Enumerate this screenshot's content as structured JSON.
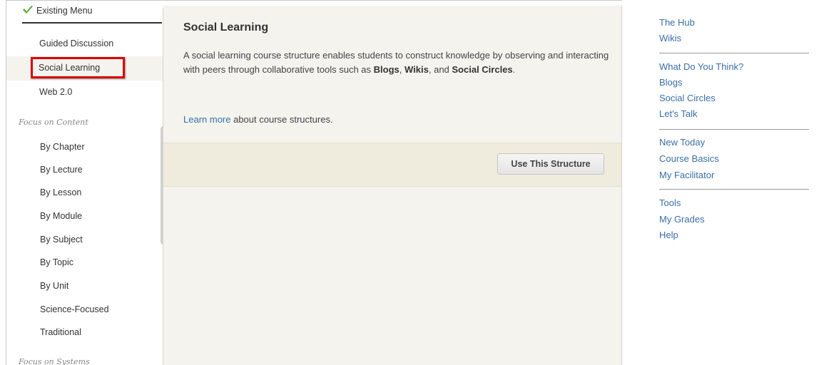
{
  "left_menu": {
    "existing_label": "Existing Menu",
    "items": [
      {
        "label": "Guided Discussion"
      },
      {
        "label": "Social Learning",
        "selected": true
      },
      {
        "label": "Web 2.0"
      }
    ],
    "section_content": "Focus on Content",
    "content_items": [
      "By Chapter",
      "By Lecture",
      "By Lesson",
      "By Module",
      "By Subject",
      "By Topic",
      "By Unit",
      "Science-Focused",
      "Traditional"
    ],
    "section_systems": "Focus on Systems"
  },
  "detail": {
    "title": "Social Learning",
    "desc_part1": "A social learning course structure enables students to construct knowledge by observing and interacting with peers through collaborative tools such as ",
    "bold1": "Blogs",
    "sep1": ", ",
    "bold2": "Wikis",
    "sep2": ", and ",
    "bold3": "Social Circles",
    "desc_end": ".",
    "learn_link": "Learn more",
    "learn_rest": " about course structures.",
    "button_label": "Use This Structure"
  },
  "preview_menu": {
    "groups": [
      [
        "The Hub",
        "Wikis"
      ],
      [
        "What Do You Think?",
        "Blogs",
        "Social Circles",
        "Let's Talk"
      ],
      [
        "New Today",
        "Course Basics",
        "My Facilitator"
      ],
      [
        "Tools",
        "My Grades",
        "Help"
      ]
    ]
  },
  "colors": {
    "accent_link": "#3a6fa8",
    "selection_border": "#d90000",
    "check_green": "#6aa83a"
  }
}
